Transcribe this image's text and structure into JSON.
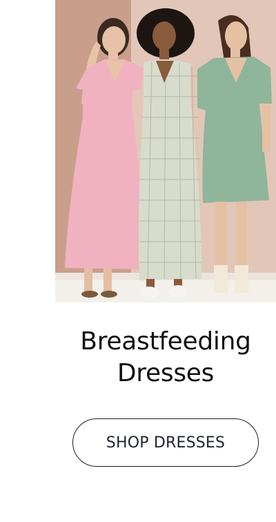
{
  "hero": {
    "image_alt": "Three women wearing pink, gingham and sage green breastfeeding dresses"
  },
  "collection": {
    "title_line1": "Breastfeeding",
    "title_line2": "Dresses"
  },
  "cta": {
    "label": "SHOP DRESSES"
  },
  "colors": {
    "text": "#111111",
    "button_border": "#1d1d1d",
    "background": "#ffffff"
  }
}
